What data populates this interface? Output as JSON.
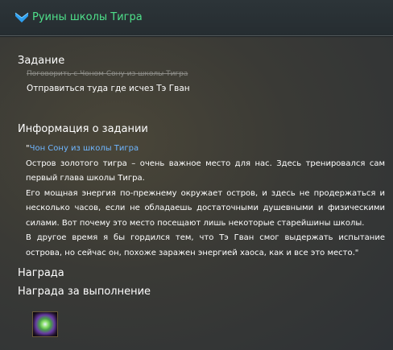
{
  "window": {
    "title": "Руины школы Тигра",
    "title_color": "#4ee08a",
    "icon": "chevron-down-icon"
  },
  "task_section": {
    "heading": "Задание",
    "completed_task": "Поговорить с Чоном Сону из школы Тигра",
    "current_task": "Отправиться туда где исчез Тэ Гван"
  },
  "info_section": {
    "heading": "Информация о задании",
    "quote_open": "\"",
    "speaker": "Чон Сону из школы Тигра",
    "speaker_color": "#6fb6ff",
    "paragraphs": [
      "Остров золотого тигра – очень важное место для нас. Здесь тренировался сам первый глава школы Тигра.",
      "Его мощная энергия по-прежнему окружает остров, и здесь не продержаться и несколько часов, если не обладаешь достаточными душевными и физическими силами. Вот почему это место посещают лишь некоторые старейшины школы.",
      "В другое время я бы гордился тем, что Тэ Гван смог выдержать испытание острова, но сейчас он, похоже заражен энергией хаоса, как и все это место.\""
    ]
  },
  "reward_section": {
    "heading": "Награда",
    "completion_heading": "Награда за выполнение",
    "item_icon": "glowing-orb-item-icon"
  }
}
